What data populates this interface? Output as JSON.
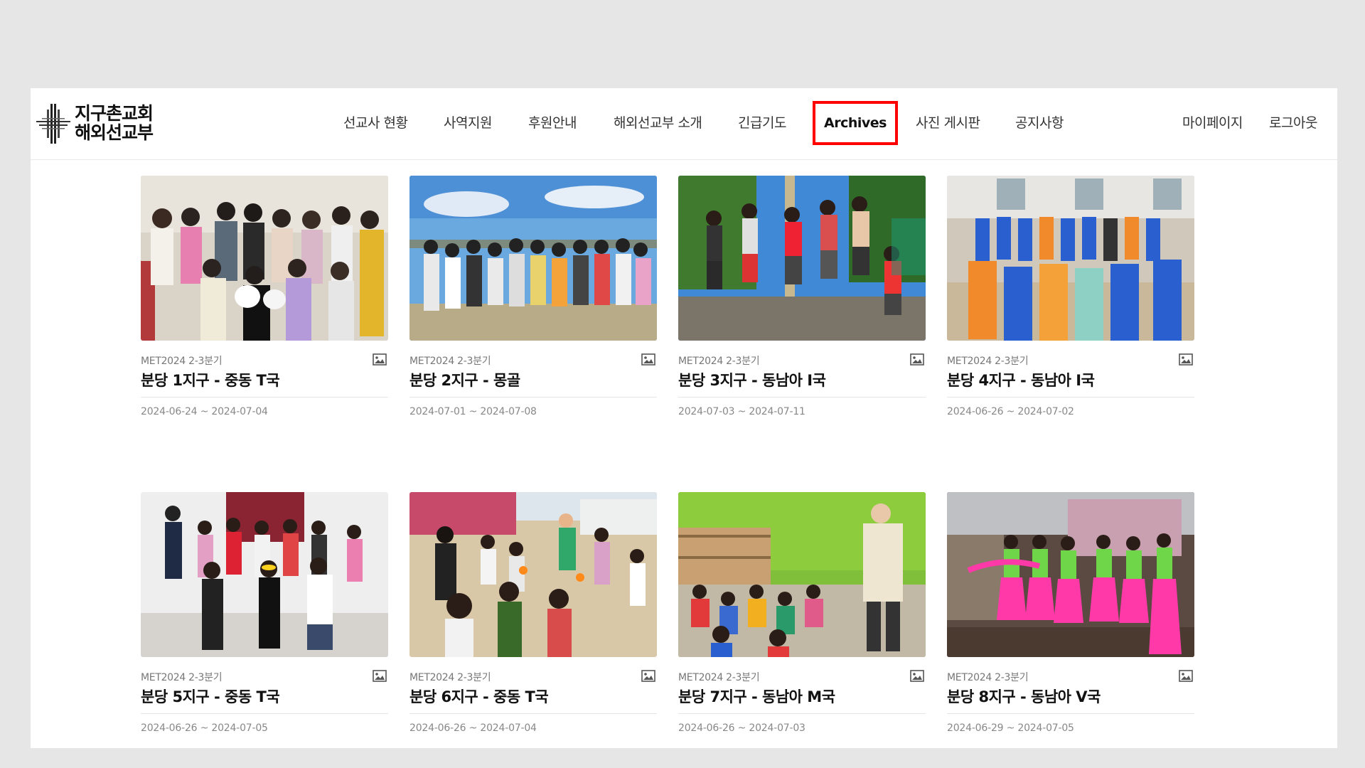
{
  "logo": {
    "line1": "지구촌교회",
    "line2": "해외선교부"
  },
  "nav": {
    "items": [
      {
        "label": "선교사 현황"
      },
      {
        "label": "사역지원"
      },
      {
        "label": "후원안내"
      },
      {
        "label": "해외선교부 소개"
      },
      {
        "label": "긴급기도"
      },
      {
        "label": "Archives"
      },
      {
        "label": "사진 게시판"
      },
      {
        "label": "공지사항"
      }
    ],
    "mypage": "마이페이지",
    "logout": "로그아웃",
    "highlight_color": "#ff0000"
  },
  "posts": [
    {
      "category": "MET2024 2-3분기",
      "title": "분당 1지구 - 중동 T국",
      "dates": "2024-06-24 ~ 2024-07-04",
      "icon": "image-icon"
    },
    {
      "category": "MET2024 2-3분기",
      "title": "분당 2지구 - 몽골",
      "dates": "2024-07-01 ~ 2024-07-08",
      "icon": "image-icon"
    },
    {
      "category": "MET2024 2-3분기",
      "title": "분당 3지구 - 동남아 I국",
      "dates": "2024-07-03 ~ 2024-07-11",
      "icon": "image-icon"
    },
    {
      "category": "MET2024 2-3분기",
      "title": "분당 4지구 - 동남아 I국",
      "dates": "2024-06-26 ~ 2024-07-02",
      "icon": "image-icon"
    },
    {
      "category": "MET2024 2-3분기",
      "title": "분당 5지구 - 중동 T국",
      "dates": "2024-06-26 ~ 2024-07-05",
      "icon": "image-icon"
    },
    {
      "category": "MET2024 2-3분기",
      "title": "분당 6지구 - 중동 T국",
      "dates": "2024-06-26 ~ 2024-07-04",
      "icon": "image-icon"
    },
    {
      "category": "MET2024 2-3분기",
      "title": "분당 7지구 - 동남아 M국",
      "dates": "2024-06-26 ~ 2024-07-03",
      "icon": "image-icon"
    },
    {
      "category": "MET2024 2-3분기",
      "title": "분당 8지구 - 동남아 V국",
      "dates": "2024-06-29 ~ 2024-07-05",
      "icon": "image-icon"
    }
  ]
}
